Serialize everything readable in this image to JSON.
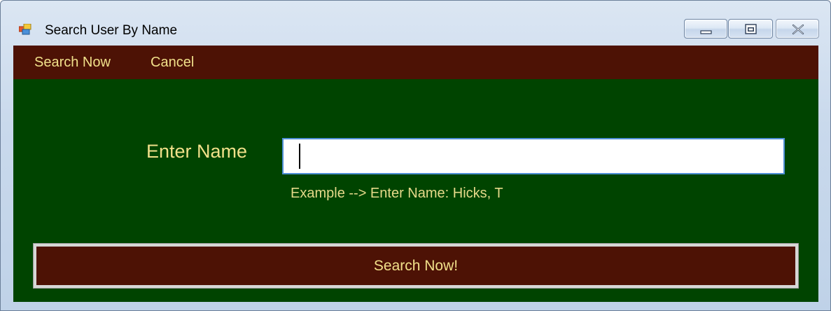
{
  "window": {
    "title": "Search User By Name",
    "icon": "windows-form-icon"
  },
  "window_controls": {
    "minimize_icon": "minimize-icon",
    "maximize_icon": "maximize-icon",
    "close_icon": "close-icon"
  },
  "menu": {
    "items": [
      {
        "label": "Search Now"
      },
      {
        "label": "Cancel"
      }
    ]
  },
  "form": {
    "name_label": "Enter Name",
    "name_value": "",
    "example_text": "Example --> Enter Name:  Hicks, T",
    "submit_label": "Search Now!"
  },
  "colors": {
    "menu_background": "#4d1205",
    "client_background": "#004400",
    "accent_text": "#f1e08a",
    "input_border": "#4f8fd6"
  }
}
